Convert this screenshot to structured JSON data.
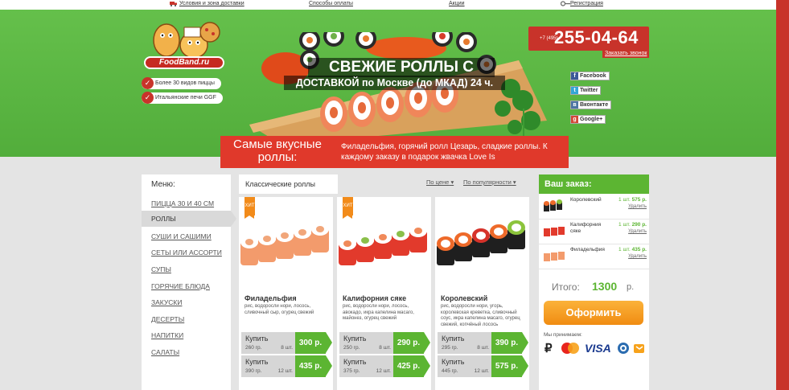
{
  "topnav": {
    "delivery": "Условия и зона доставки",
    "payment": "Способы оплаты",
    "promo": "Акции",
    "register": "Регистрация"
  },
  "logo": {
    "text": "FoodBand.ru"
  },
  "features": [
    "Более 30 видов пиццы",
    "Итальянские печи GGF"
  ],
  "promo": {
    "line1": "СВЕЖИЕ РОЛЛЫ С",
    "line2": "ДОСТАВКОЙ по Москве (до МКАД) 24 ч."
  },
  "phone": {
    "prefix": "+7 (495)",
    "number": "255-04-64",
    "callback": "Заказать звонок"
  },
  "social": [
    "Facebook",
    "Twitter",
    "Вконтакте",
    "Google+"
  ],
  "banner": {
    "title": "Самые вкусные роллы:",
    "subtitle": "Филадельфия, горячий ролл Цезарь, сладкие роллы. К каждому заказу в подарок жвачка Love Is"
  },
  "menu": {
    "title": "Меню:",
    "items": [
      "ПИЦЦА 30 И 40 СМ",
      "РОЛЛЫ",
      "СУШИ И САШИМИ",
      "СЕТЫ ИЛИ АССОРТИ",
      "СУПЫ",
      "ГОРЯЧИЕ БЛЮДА",
      "ЗАКУСКИ",
      "ДЕСЕРТЫ",
      "НАПИТКИ",
      "САЛАТЫ"
    ],
    "active_index": 1
  },
  "category": {
    "title": "Классические роллы",
    "sort_price": "По цене",
    "sort_popular": "По популярности"
  },
  "products": [
    {
      "badge": "ХИТ",
      "name": "Филадельфия",
      "desc": "рис, водоросли нори, лосось, сливочный сыр, огурец свежий",
      "options": [
        {
          "label": "Купить",
          "weight": "260 гр.",
          "pcs": "8 шт.",
          "price": "300 р."
        },
        {
          "label": "Купить",
          "weight": "390 гр.",
          "pcs": "12 шт.",
          "price": "435 р."
        }
      ]
    },
    {
      "badge": "ХИТ",
      "name": "Калифорния сяке",
      "desc": "рис, водоросли нори, лосось, авокадо, икра капелина масаго, майонез, огурец свежий",
      "options": [
        {
          "label": "Купить",
          "weight": "250 гр.",
          "pcs": "8 шт.",
          "price": "290 р."
        },
        {
          "label": "Купить",
          "weight": "375 гр.",
          "pcs": "12 шт.",
          "price": "425 р."
        }
      ]
    },
    {
      "badge": "",
      "name": "Королевский",
      "desc": "рис, водоросли нори, угорь, королевская креветка, сливочный соус, икра капелина масаго, огурец свежий, копчёный лосось",
      "options": [
        {
          "label": "Купить",
          "weight": "295 гр.",
          "pcs": "8 шт.",
          "price": "390 р."
        },
        {
          "label": "Купить",
          "weight": "445 гр.",
          "pcs": "12 шт.",
          "price": "575 р."
        }
      ]
    }
  ],
  "order": {
    "title": "Ваш заказ:",
    "items": [
      {
        "name": "Королевский",
        "qty": "1 шт.",
        "price": "575 р.",
        "remove": "Удалить"
      },
      {
        "name": "Калифорния сяке",
        "qty": "1 шт.",
        "price": "290 р.",
        "remove": "Удалить"
      },
      {
        "name": "Филадельфия",
        "qty": "1 шт.",
        "price": "435 р.",
        "remove": "Удалить"
      }
    ],
    "total_label": "Итого:",
    "total_value": "1300",
    "total_unit": "р.",
    "checkout": "Оформить",
    "accept": "Мы принимаем:",
    "payment_methods": [
      "ruble-icon",
      "mastercard-icon",
      "visa-icon",
      "webmoney-icon",
      "yandex-money-icon"
    ]
  },
  "colors": {
    "header_green": "#5cb532",
    "accent_red": "#c8332a",
    "banner_red": "#e0392b",
    "checkout_orange": "#f08c12"
  }
}
